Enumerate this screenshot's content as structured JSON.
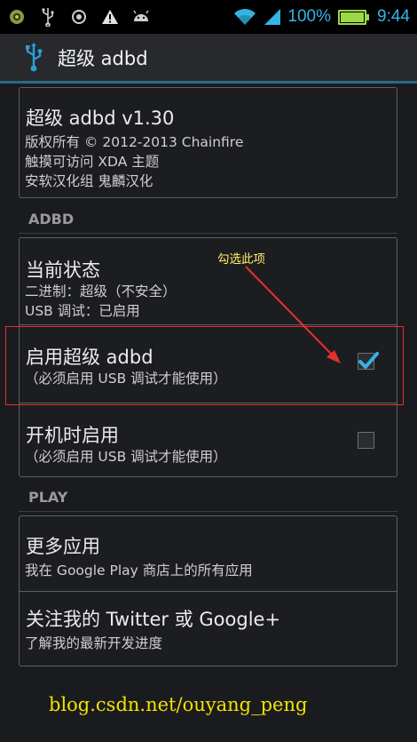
{
  "status_bar": {
    "icons": [
      "android-debug-icon",
      "usb-icon",
      "target-icon",
      "warning-icon",
      "android-icon",
      "wifi-icon",
      "signal-icon",
      "battery-icon"
    ],
    "battery_text": "100%",
    "time": "9:44",
    "accent_color": "#34b4e4"
  },
  "action_bar": {
    "title": "超级 adbd",
    "icon": "usb-icon"
  },
  "about": {
    "title": "超级 adbd v1.30",
    "lines": [
      "版权所有 © 2012-2013 Chainfire",
      "触摸可访问 XDA 主题",
      "安软汉化组 鬼麟汉化"
    ]
  },
  "sections": {
    "adbd": "ADBD",
    "play": "PLAY"
  },
  "adbd_items": [
    {
      "title": "当前状态",
      "lines": [
        "二进制：超级（不安全）",
        "USB 调试：已启用"
      ]
    },
    {
      "title": "启用超级 adbd",
      "lines": [
        "（必须启用 USB 调试才能使用）"
      ],
      "checked": true
    },
    {
      "title": "开机时启用",
      "lines": [
        "（必须启用 USB 调试才能使用）"
      ],
      "checked": false
    }
  ],
  "play_items": [
    {
      "title": "更多应用",
      "lines": [
        "我在 Google Play 商店上的所有应用"
      ]
    },
    {
      "title": "关注我的 Twitter 或 Google+",
      "lines": [
        "了解我的最新开发进度"
      ]
    }
  ],
  "annotation": {
    "text": "勾选此项",
    "color": "#e5312d",
    "text_color": "#fff060"
  },
  "watermark": "blog.csdn.net/ouyang_peng"
}
